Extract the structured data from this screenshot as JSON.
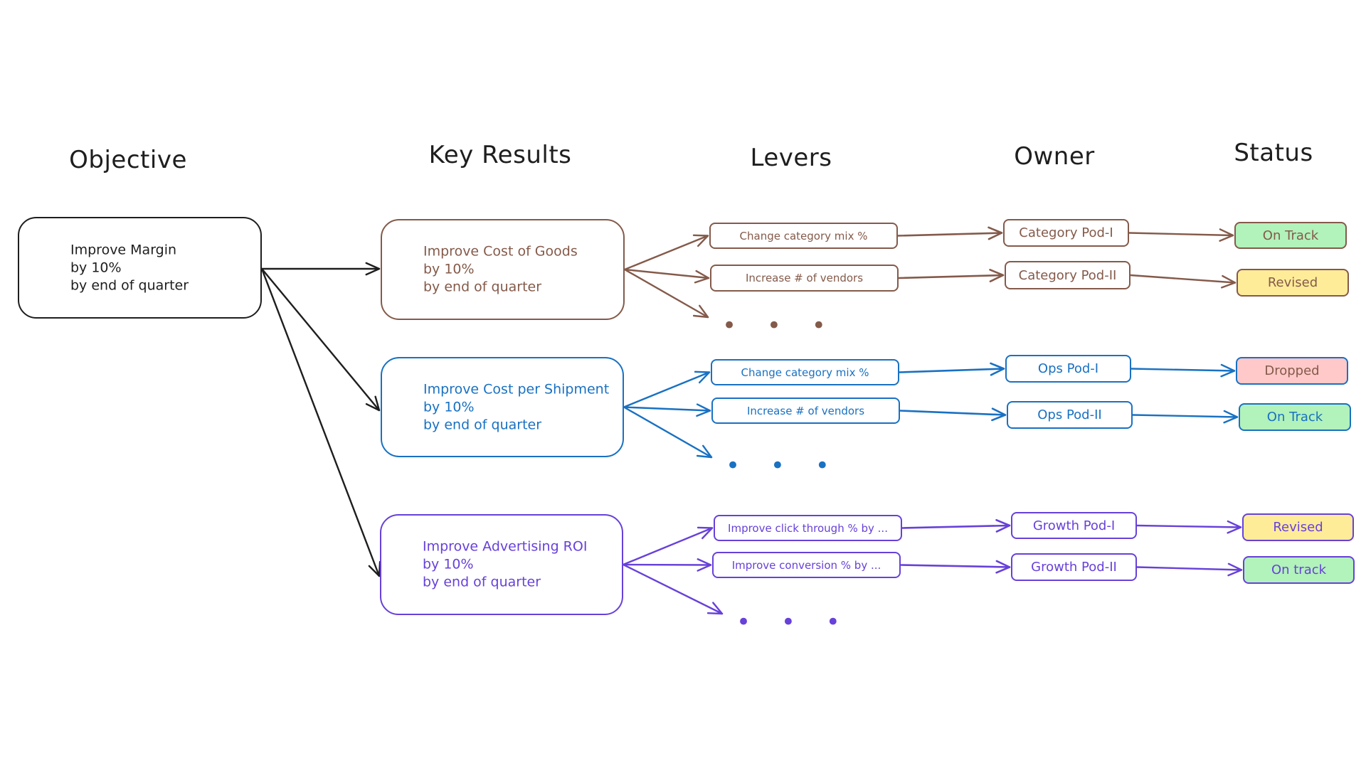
{
  "headers": {
    "objective": "Objective",
    "key_results": "Key Results",
    "levers": "Levers",
    "owner": "Owner",
    "status": "Status"
  },
  "objective": {
    "lines": "Improve Margin\nby 10%\nby end of quarter",
    "color": "#1e1e1e"
  },
  "key_results": [
    {
      "text": "Improve Cost of Goods\nby 10%\nby end of quarter",
      "color": "#845a4a",
      "levers": [
        {
          "label": "Change category mix %",
          "owner": "Category Pod-I",
          "status": "On Track",
          "status_color": "#b2f2bb",
          "status_text_color": "#845a4a"
        },
        {
          "label": "Increase # of vendors",
          "owner": "Category Pod-II",
          "status": "Revised",
          "status_color": "#ffec99",
          "status_text_color": "#845a4a"
        }
      ],
      "more": "• • •"
    },
    {
      "text": "Improve Cost per Shipment\nby 10%\nby end of quarter",
      "color": "#1971c2",
      "levers": [
        {
          "label": "Change category mix %",
          "owner": "Ops Pod-I",
          "status": "Dropped",
          "status_color": "#ffc9c9",
          "status_text_color": "#845a4a"
        },
        {
          "label": "Increase # of vendors",
          "owner": "Ops Pod-II",
          "status": "On Track",
          "status_color": "#b2f2bb",
          "status_text_color": "#1971c2"
        }
      ],
      "more": "• • •"
    },
    {
      "text": "Improve Advertising ROI\nby 10%\nby end of quarter",
      "color": "#6741d9",
      "levers": [
        {
          "label": "Improve click through % by ...",
          "owner": "Growth Pod-I",
          "status": "Revised",
          "status_color": "#ffec99",
          "status_text_color": "#6741d9"
        },
        {
          "label": "Improve conversion % by ...",
          "owner": "Growth Pod-II",
          "status": "On track",
          "status_color": "#b2f2bb",
          "status_text_color": "#6741d9"
        }
      ],
      "more": "• • •"
    }
  ]
}
